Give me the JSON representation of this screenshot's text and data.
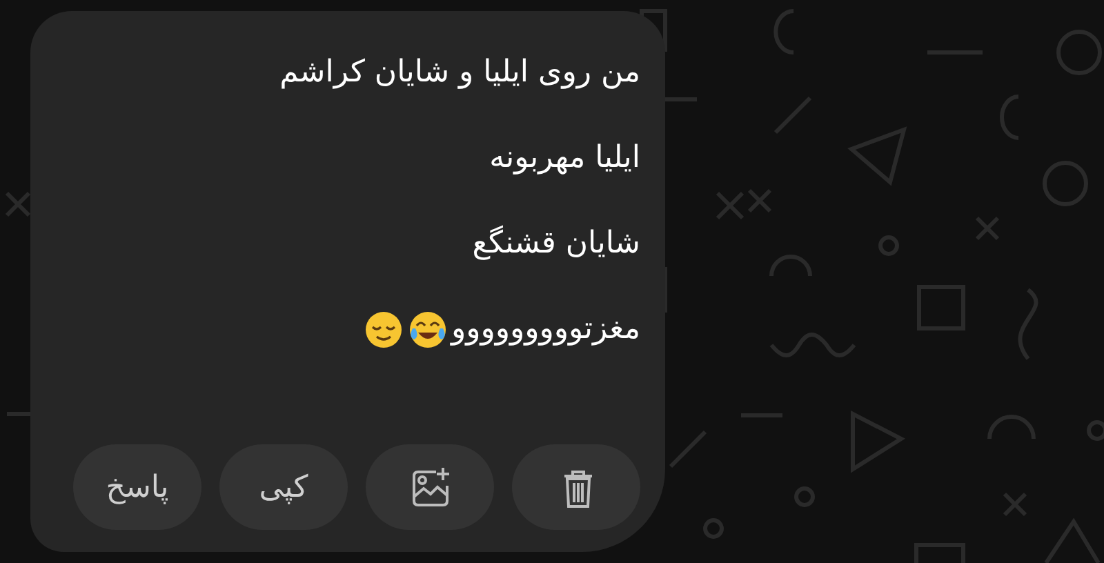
{
  "message": {
    "lines": [
      "من روی ایلیا و شایان کراشم",
      "ایلیا مهربونه",
      "شایان قشنگع",
      "مغزتووووووووو"
    ]
  },
  "actions": [
    {
      "kind": "delete"
    },
    {
      "kind": "add_image"
    },
    {
      "kind": "text",
      "label": "کپی"
    },
    {
      "kind": "text",
      "label": "پاسخ"
    }
  ]
}
